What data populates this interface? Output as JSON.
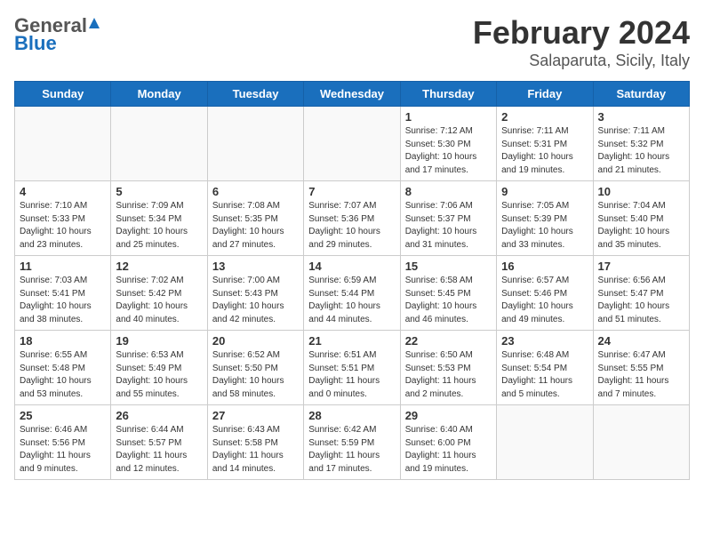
{
  "header": {
    "logo_general": "General",
    "logo_blue": "Blue",
    "month_year": "February 2024",
    "location": "Salaparuta, Sicily, Italy"
  },
  "days_of_week": [
    "Sunday",
    "Monday",
    "Tuesday",
    "Wednesday",
    "Thursday",
    "Friday",
    "Saturday"
  ],
  "weeks": [
    [
      {
        "num": "",
        "info": ""
      },
      {
        "num": "",
        "info": ""
      },
      {
        "num": "",
        "info": ""
      },
      {
        "num": "",
        "info": ""
      },
      {
        "num": "1",
        "info": "Sunrise: 7:12 AM\nSunset: 5:30 PM\nDaylight: 10 hours and 17 minutes."
      },
      {
        "num": "2",
        "info": "Sunrise: 7:11 AM\nSunset: 5:31 PM\nDaylight: 10 hours and 19 minutes."
      },
      {
        "num": "3",
        "info": "Sunrise: 7:11 AM\nSunset: 5:32 PM\nDaylight: 10 hours and 21 minutes."
      }
    ],
    [
      {
        "num": "4",
        "info": "Sunrise: 7:10 AM\nSunset: 5:33 PM\nDaylight: 10 hours and 23 minutes."
      },
      {
        "num": "5",
        "info": "Sunrise: 7:09 AM\nSunset: 5:34 PM\nDaylight: 10 hours and 25 minutes."
      },
      {
        "num": "6",
        "info": "Sunrise: 7:08 AM\nSunset: 5:35 PM\nDaylight: 10 hours and 27 minutes."
      },
      {
        "num": "7",
        "info": "Sunrise: 7:07 AM\nSunset: 5:36 PM\nDaylight: 10 hours and 29 minutes."
      },
      {
        "num": "8",
        "info": "Sunrise: 7:06 AM\nSunset: 5:37 PM\nDaylight: 10 hours and 31 minutes."
      },
      {
        "num": "9",
        "info": "Sunrise: 7:05 AM\nSunset: 5:39 PM\nDaylight: 10 hours and 33 minutes."
      },
      {
        "num": "10",
        "info": "Sunrise: 7:04 AM\nSunset: 5:40 PM\nDaylight: 10 hours and 35 minutes."
      }
    ],
    [
      {
        "num": "11",
        "info": "Sunrise: 7:03 AM\nSunset: 5:41 PM\nDaylight: 10 hours and 38 minutes."
      },
      {
        "num": "12",
        "info": "Sunrise: 7:02 AM\nSunset: 5:42 PM\nDaylight: 10 hours and 40 minutes."
      },
      {
        "num": "13",
        "info": "Sunrise: 7:00 AM\nSunset: 5:43 PM\nDaylight: 10 hours and 42 minutes."
      },
      {
        "num": "14",
        "info": "Sunrise: 6:59 AM\nSunset: 5:44 PM\nDaylight: 10 hours and 44 minutes."
      },
      {
        "num": "15",
        "info": "Sunrise: 6:58 AM\nSunset: 5:45 PM\nDaylight: 10 hours and 46 minutes."
      },
      {
        "num": "16",
        "info": "Sunrise: 6:57 AM\nSunset: 5:46 PM\nDaylight: 10 hours and 49 minutes."
      },
      {
        "num": "17",
        "info": "Sunrise: 6:56 AM\nSunset: 5:47 PM\nDaylight: 10 hours and 51 minutes."
      }
    ],
    [
      {
        "num": "18",
        "info": "Sunrise: 6:55 AM\nSunset: 5:48 PM\nDaylight: 10 hours and 53 minutes."
      },
      {
        "num": "19",
        "info": "Sunrise: 6:53 AM\nSunset: 5:49 PM\nDaylight: 10 hours and 55 minutes."
      },
      {
        "num": "20",
        "info": "Sunrise: 6:52 AM\nSunset: 5:50 PM\nDaylight: 10 hours and 58 minutes."
      },
      {
        "num": "21",
        "info": "Sunrise: 6:51 AM\nSunset: 5:51 PM\nDaylight: 11 hours and 0 minutes."
      },
      {
        "num": "22",
        "info": "Sunrise: 6:50 AM\nSunset: 5:53 PM\nDaylight: 11 hours and 2 minutes."
      },
      {
        "num": "23",
        "info": "Sunrise: 6:48 AM\nSunset: 5:54 PM\nDaylight: 11 hours and 5 minutes."
      },
      {
        "num": "24",
        "info": "Sunrise: 6:47 AM\nSunset: 5:55 PM\nDaylight: 11 hours and 7 minutes."
      }
    ],
    [
      {
        "num": "25",
        "info": "Sunrise: 6:46 AM\nSunset: 5:56 PM\nDaylight: 11 hours and 9 minutes."
      },
      {
        "num": "26",
        "info": "Sunrise: 6:44 AM\nSunset: 5:57 PM\nDaylight: 11 hours and 12 minutes."
      },
      {
        "num": "27",
        "info": "Sunrise: 6:43 AM\nSunset: 5:58 PM\nDaylight: 11 hours and 14 minutes."
      },
      {
        "num": "28",
        "info": "Sunrise: 6:42 AM\nSunset: 5:59 PM\nDaylight: 11 hours and 17 minutes."
      },
      {
        "num": "29",
        "info": "Sunrise: 6:40 AM\nSunset: 6:00 PM\nDaylight: 11 hours and 19 minutes."
      },
      {
        "num": "",
        "info": ""
      },
      {
        "num": "",
        "info": ""
      }
    ]
  ]
}
